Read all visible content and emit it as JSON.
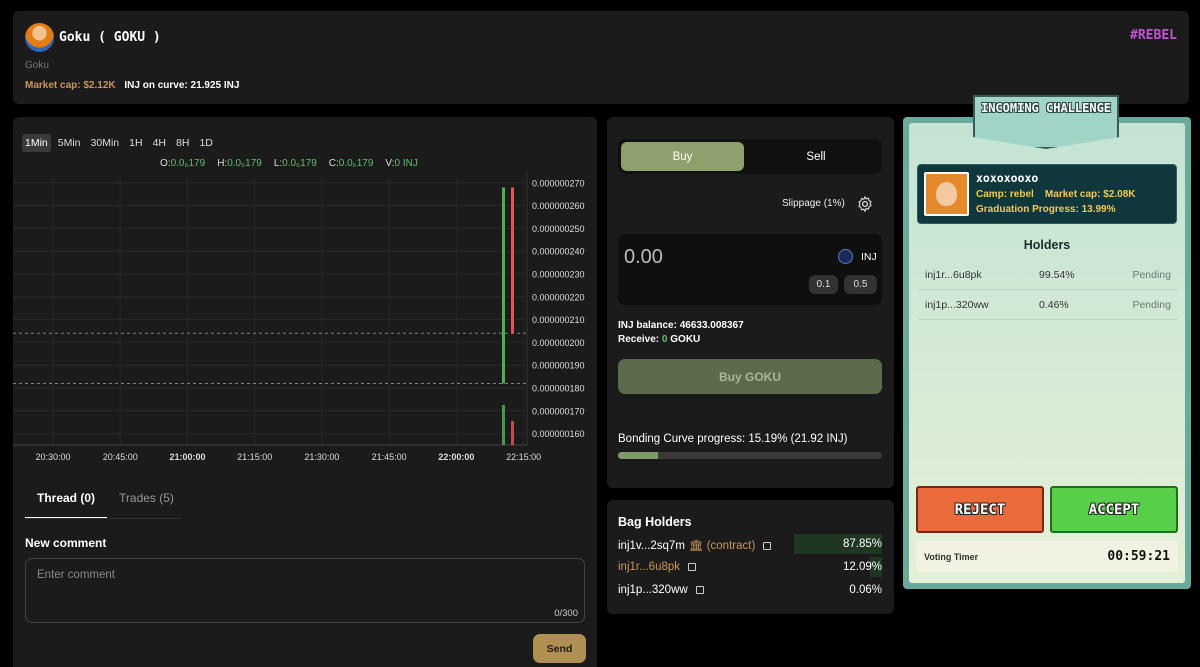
{
  "header": {
    "title": "Goku ( GOKU )",
    "subtitle": "Goku",
    "market_cap": "Market cap: $2.12K",
    "inj_on_curve": "INJ on curve: 21.925 INJ",
    "tag": "#REBEL"
  },
  "chart": {
    "timeframes": [
      "1Min",
      "5Min",
      "30Min",
      "1H",
      "4H",
      "8H",
      "1D"
    ],
    "active_timeframe": "1Min",
    "ohlc": {
      "o_label": "O:",
      "o_value": "0.0₆179",
      "h_label": "H:",
      "h_value": "0.0₆179",
      "l_label": "L:",
      "l_value": "0.0₆179",
      "c_label": "C:",
      "c_value": "0.0₆179",
      "v_label": "V:",
      "v_value": "0 INJ"
    },
    "up_color": "#4caf50",
    "down_color": "#e05555"
  },
  "chart_data": {
    "type": "candlestick",
    "x_ticks": [
      "20:30:00",
      "20:45:00",
      "21:00:00",
      "21:15:00",
      "21:30:00",
      "21:45:00",
      "22:00:00",
      "22:15:00"
    ],
    "y_ticks": [
      "0.000000270",
      "0.000000260",
      "0.000000250",
      "0.000000240",
      "0.000000230",
      "0.000000220",
      "0.000000210",
      "0.000000200",
      "0.000000190",
      "0.000000180",
      "0.000000170",
      "0.000000160"
    ],
    "ylim": [
      1.55e-07,
      2.73e-07
    ],
    "candles": [
      {
        "open": 1.82e-07,
        "high": 2.68e-07,
        "low": 1.82e-07,
        "close": 2.68e-07
      },
      {
        "open": 2.68e-07,
        "high": 2.68e-07,
        "low": 2.04e-07,
        "close": 2.04e-07
      }
    ],
    "volume": [
      {
        "value": 1.0,
        "direction": "up"
      },
      {
        "value": 0.6,
        "direction": "down"
      }
    ],
    "grid": true
  },
  "comments": {
    "tabs": [
      "Thread (0)",
      "Trades (5)"
    ],
    "new_comment_label": "New comment",
    "placeholder": "Enter comment",
    "char_count": "0/300",
    "send_label": "Send"
  },
  "trade": {
    "buy_label": "Buy",
    "sell_label": "Sell",
    "slippage": "Slippage (1%)",
    "amount": "0.00",
    "currency": "INJ",
    "presets": [
      "0.1",
      "0.5"
    ],
    "balance_label": "INJ balance:",
    "balance_value": "46633.008367",
    "receive_label": "Receive:",
    "receive_amount": "0",
    "receive_token": "GOKU",
    "buy_button": "Buy GOKU",
    "bonding_text": "Bonding Curve progress: 15.19% (21.92 INJ)",
    "bonding_progress": 15.19
  },
  "bag_holders": {
    "title": "Bag Holders",
    "rows": [
      {
        "address": "inj1v...2sq7m",
        "extra": "🏛 (contract)",
        "percent": "87.85%",
        "share": 87.85
      },
      {
        "address": "inj1r...6u8pk",
        "extra": "",
        "percent": "12.09%",
        "share": 12.09
      },
      {
        "address": "inj1p...320ww",
        "extra": "",
        "percent": "0.06%",
        "share": 0.06
      }
    ]
  },
  "challenge": {
    "banner": "INCOMING CHALLENGE",
    "name": "xoxoxooxo",
    "camp": "Camp: rebel",
    "market_cap": "Market cap: $2.08K",
    "graduation": "Graduation Progress: 13.99%",
    "holders_title": "Holders",
    "holders": [
      {
        "address": "inj1r...6u8pk",
        "percent": "99.54%",
        "status": "Pending"
      },
      {
        "address": "inj1p...320ww",
        "percent": "0.46%",
        "status": "Pending"
      }
    ],
    "reject_label": "REJECT",
    "accept_label": "ACCEPT",
    "timer_label": "Voting Timer",
    "timer_value": "00:59:21"
  }
}
